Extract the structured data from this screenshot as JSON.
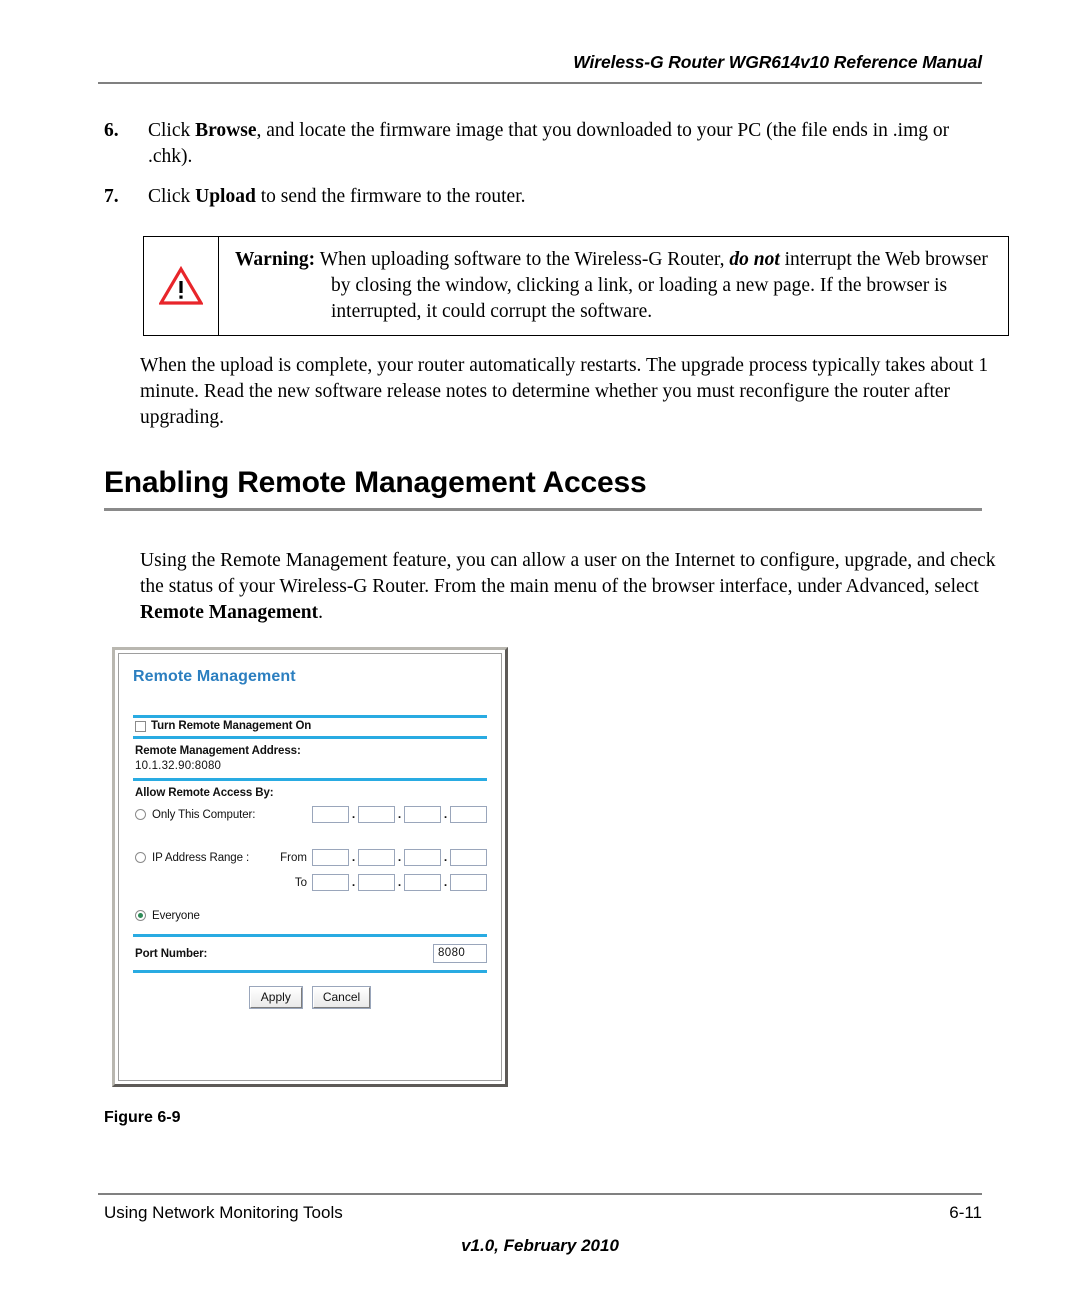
{
  "header": {
    "running_title": "Wireless-G Router WGR614v10 Reference Manual"
  },
  "steps": [
    {
      "number": "6.",
      "text_before": "Click ",
      "bold": "Browse",
      "text_after": ", and locate the firmware image that you downloaded to your PC (the file ends in .img or .chk)."
    },
    {
      "number": "7.",
      "text_before": "Click ",
      "bold": "Upload",
      "text_after": " to send the firmware to the router."
    }
  ],
  "warning": {
    "icon": "warning-triangle-icon",
    "label": "Warning:",
    "text_part1": " When uploading software to the Wireless-G Router, ",
    "emphasis": "do not",
    "text_part2": " interrupt the Web browser by closing the window, clicking a link, or loading a new page. If the browser is interrupted, it could corrupt the software."
  },
  "paragraphs": {
    "upload_complete": "When the upload is complete, your router automatically restarts. The upgrade process typically takes about 1 minute. Read the new software release notes to determine whether you must reconfigure the router after upgrading.",
    "remote_intro_part1": "Using the Remote Management feature, you can allow a user on the Internet to configure, upgrade, and check the status of your Wireless-G Router. From the main menu of the browser interface, under Advanced, select ",
    "remote_intro_bold": "Remote Management",
    "remote_intro_part2": "."
  },
  "section": {
    "heading": "Enabling Remote Management Access"
  },
  "figure": {
    "caption": "Figure 6-9",
    "screenshot": {
      "title": "Remote Management",
      "enable_checkbox": {
        "label": "Turn Remote Management On",
        "checked": false
      },
      "address": {
        "label": "Remote Management Address:",
        "value": "10.1.32.90:8080"
      },
      "access": {
        "label": "Allow Remote Access By:",
        "options": [
          {
            "id": "only-this-computer",
            "label": "Only This Computer:",
            "selected": false
          },
          {
            "id": "ip-address-range",
            "label": "IP Address Range :",
            "selected": false
          },
          {
            "id": "everyone",
            "label": "Everyone",
            "selected": true
          }
        ],
        "from_label": "From",
        "to_label": "To",
        "octet_separator": ".",
        "only_this_computer_octets": [
          "",
          "",
          "",
          ""
        ],
        "range_from_octets": [
          "",
          "",
          "",
          ""
        ],
        "range_to_octets": [
          "",
          "",
          "",
          ""
        ]
      },
      "port": {
        "label": "Port Number:",
        "value": "8080"
      },
      "buttons": {
        "apply": "Apply",
        "cancel": "Cancel"
      },
      "colors": {
        "title_blue": "#2c7fc0",
        "divider_cyan": "#29abe2",
        "radio_selected": "#2e8b57"
      }
    }
  },
  "footer": {
    "left": "Using Network Monitoring Tools",
    "right": "6-11",
    "center": "v1.0, February 2010"
  }
}
